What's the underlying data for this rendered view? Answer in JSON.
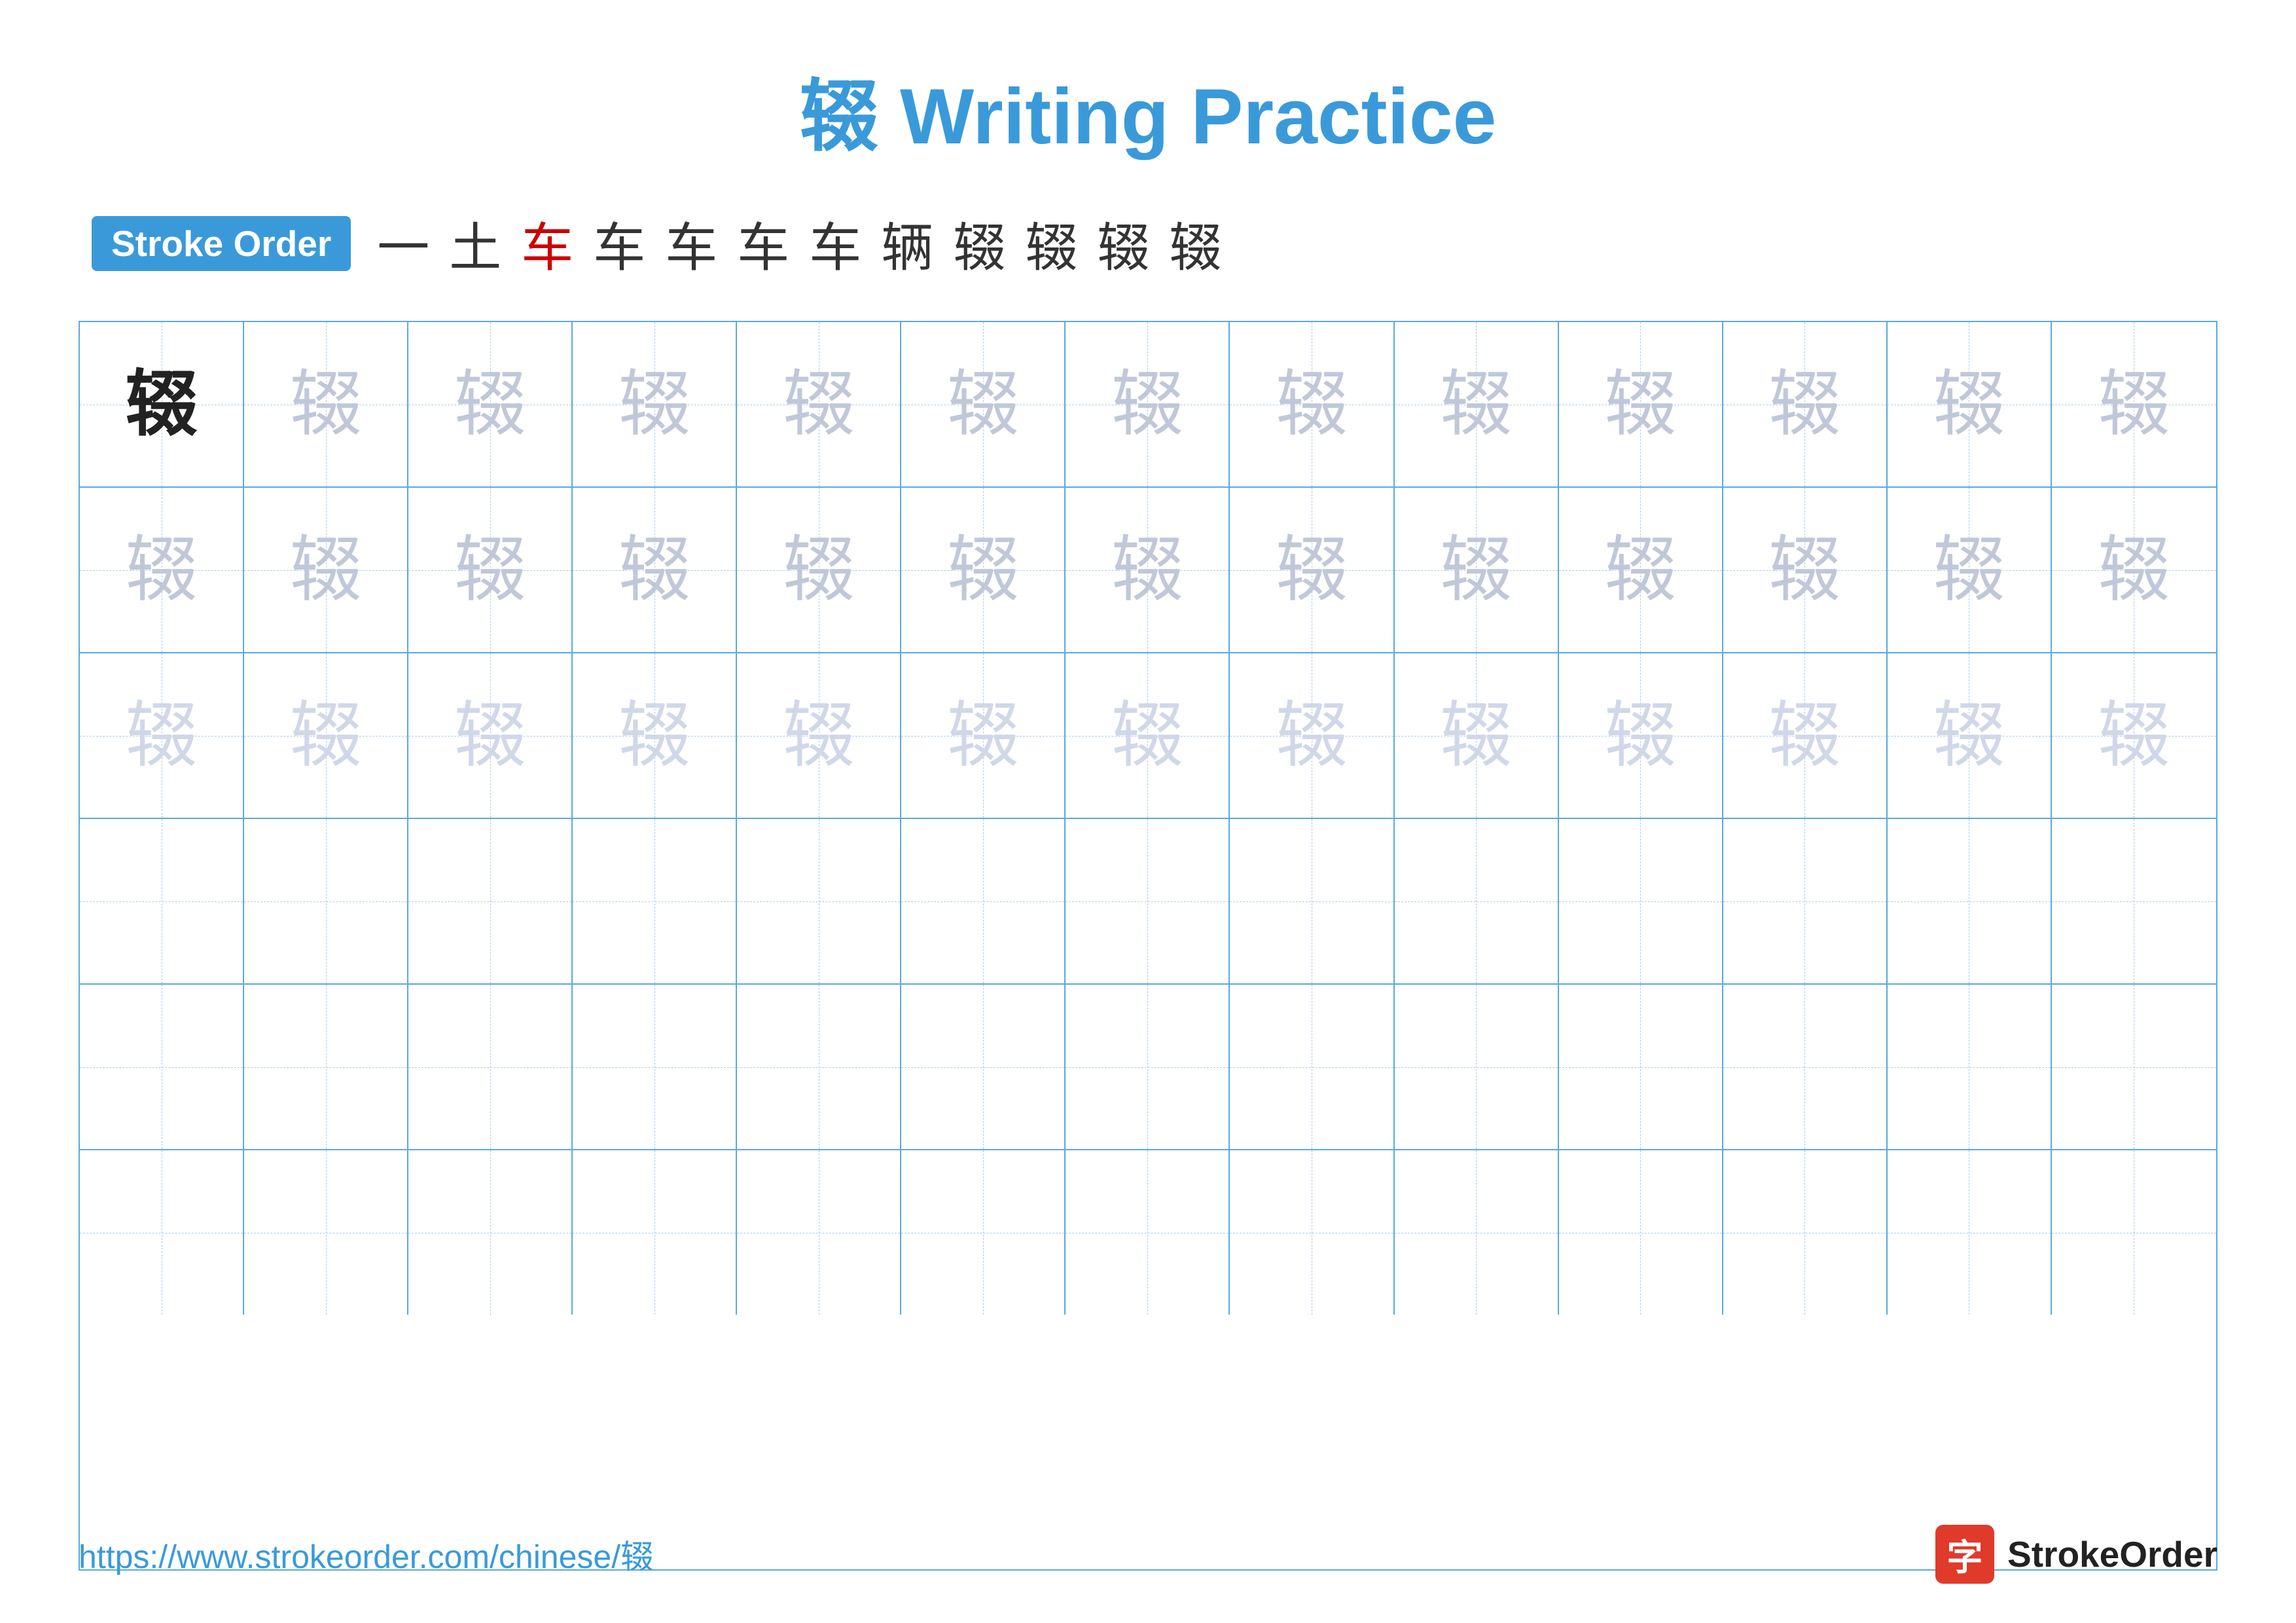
{
  "title": {
    "char": "辍",
    "label": "Writing Practice",
    "full": "辍 Writing Practice"
  },
  "stroke_order": {
    "badge_label": "Stroke Order",
    "strokes": [
      "一",
      "土",
      "车",
      "车",
      "车",
      "车",
      "车",
      "辆",
      "辍",
      "辍",
      "辍",
      "辍"
    ]
  },
  "grid": {
    "rows": 6,
    "cols": 13,
    "char": "辍",
    "row_types": [
      "dark_then_light1",
      "light1",
      "light2",
      "empty",
      "empty",
      "empty"
    ]
  },
  "footer": {
    "url": "https://www.strokeorder.com/chinese/辍",
    "brand_icon": "字",
    "brand_name": "StrokeOrder"
  }
}
